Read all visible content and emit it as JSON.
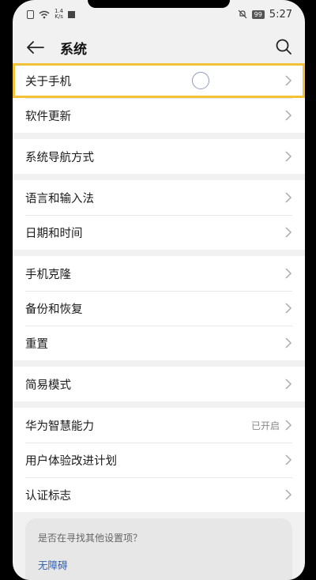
{
  "status_bar": {
    "speed_value": "1.4",
    "speed_unit": "K/s",
    "battery": "99",
    "time": "5:27"
  },
  "app_bar": {
    "title": "系统",
    "back_icon": "arrow-left-icon",
    "search_icon": "search-icon"
  },
  "groups": [
    {
      "items": [
        {
          "label": "关于手机",
          "highlighted": true
        },
        {
          "label": "软件更新"
        }
      ]
    },
    {
      "items": [
        {
          "label": "系统导航方式"
        }
      ]
    },
    {
      "items": [
        {
          "label": "语言和输入法"
        },
        {
          "label": "日期和时间"
        }
      ]
    },
    {
      "items": [
        {
          "label": "手机克隆"
        },
        {
          "label": "备份和恢复"
        },
        {
          "label": "重置"
        }
      ]
    },
    {
      "items": [
        {
          "label": "简易模式"
        }
      ]
    },
    {
      "items": [
        {
          "label": "华为智慧能力",
          "status": "已开启"
        },
        {
          "label": "用户体验改进计划"
        },
        {
          "label": "认证标志"
        }
      ]
    }
  ],
  "suggestion": {
    "title": "是否在寻找其他设置项？",
    "link": "无障碍"
  },
  "colors": {
    "highlight": "#f3c23a",
    "link": "#2f5fb0",
    "background": "#f1f1f1"
  }
}
